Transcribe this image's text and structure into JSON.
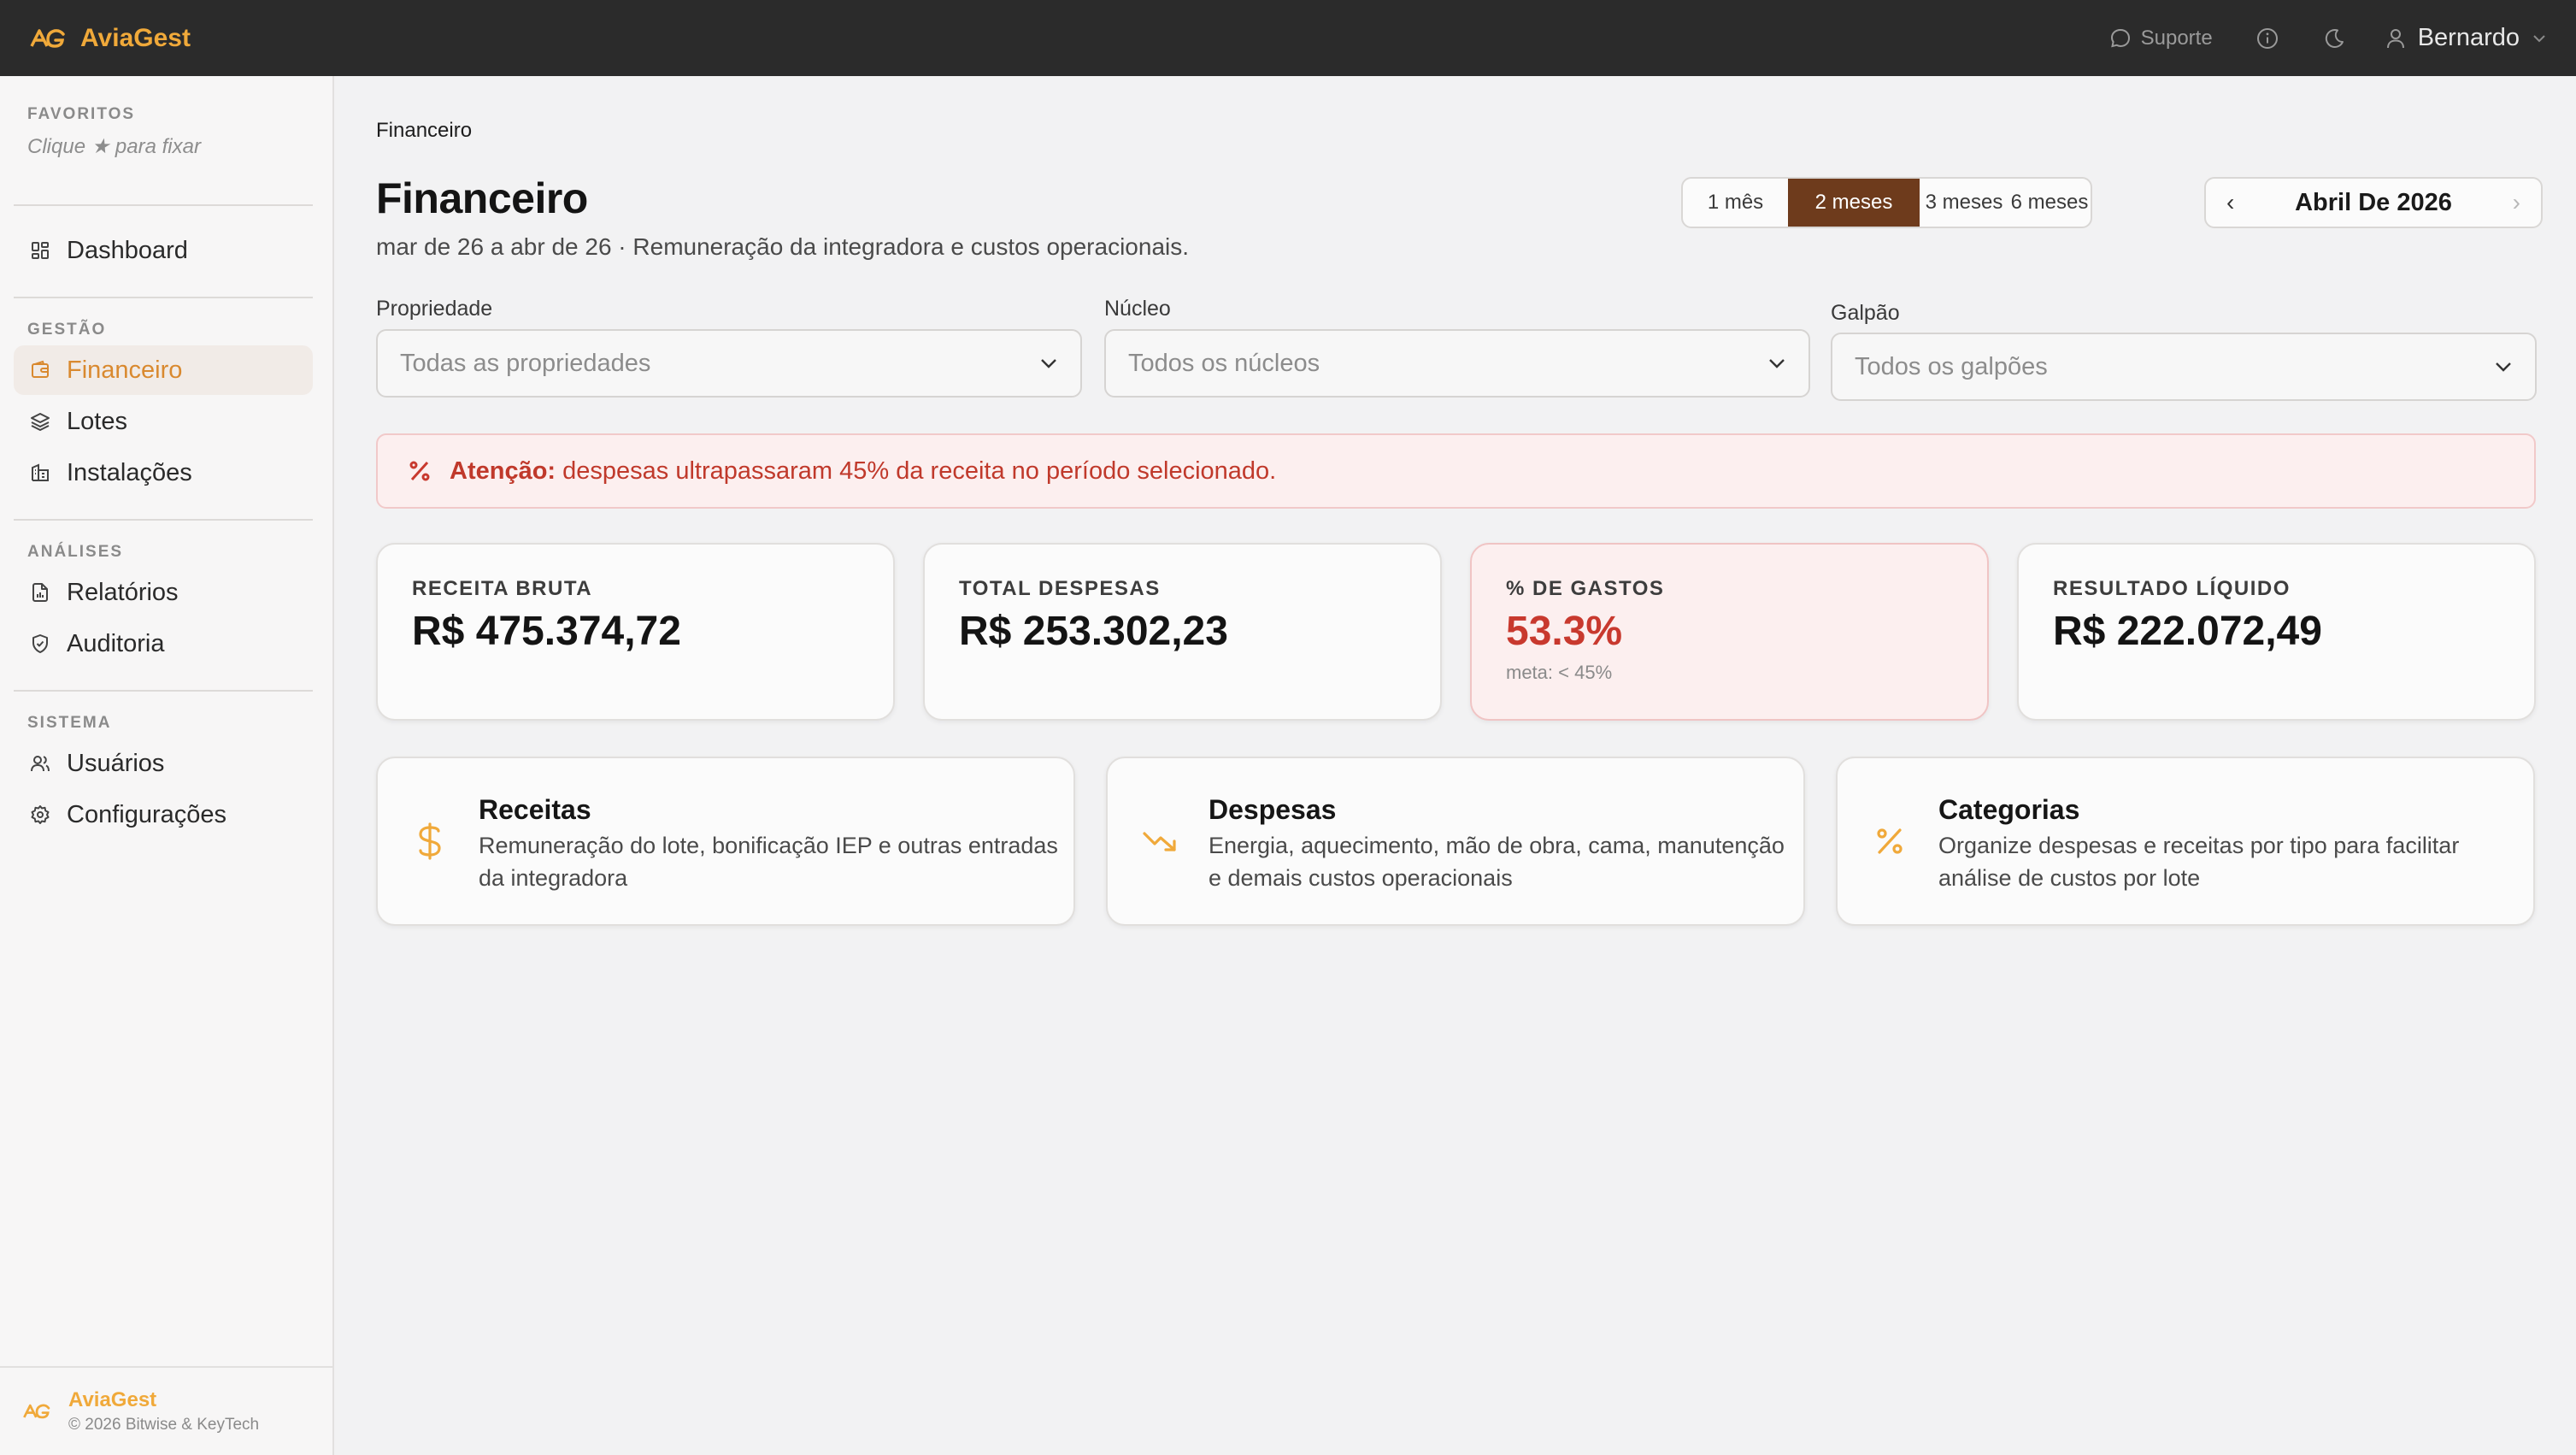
{
  "app": {
    "name": "AviaGest",
    "support_label": "Suporte",
    "user_name": "Bernardo"
  },
  "sidebar": {
    "favorites_title": "FAVORITOS",
    "favorites_hint": "Clique ★ para fixar",
    "dashboard_label": "Dashboard",
    "gestao_title": "GESTÃO",
    "gestao_items": [
      {
        "label": "Financeiro",
        "icon": "wallet-icon"
      },
      {
        "label": "Lotes",
        "icon": "layers-icon"
      },
      {
        "label": "Instalações",
        "icon": "building-icon"
      }
    ],
    "analises_title": "ANÁLISES",
    "analises_items": [
      {
        "label": "Relatórios",
        "icon": "report-icon"
      },
      {
        "label": "Auditoria",
        "icon": "shield-icon"
      }
    ],
    "sistema_title": "SISTEMA",
    "sistema_items": [
      {
        "label": "Usuários",
        "icon": "users-icon"
      },
      {
        "label": "Configurações",
        "icon": "gear-icon"
      }
    ],
    "footer_name": "AviaGest",
    "footer_copy": "© 2026 Bitwise & KeyTech"
  },
  "page": {
    "breadcrumb": "Financeiro",
    "title": "Financeiro",
    "subtitle": "mar de 26 a abr de 26 · Remuneração da integradora e custos operacionais."
  },
  "range": {
    "options": [
      "1 mês",
      "2 meses",
      "3 meses",
      "6 meses"
    ],
    "selected": "2 meses"
  },
  "month_nav": {
    "label": "Abril De 2026",
    "prev": "‹",
    "next": "›"
  },
  "filters": [
    {
      "label": "Propriedade",
      "placeholder": "Todas as propriedades"
    },
    {
      "label": "Núcleo",
      "placeholder": "Todos os núcleos"
    },
    {
      "label": "Galpão",
      "placeholder": "Todos os galpões"
    }
  ],
  "alert": {
    "strong": "Atenção:",
    "text": "despesas ultrapassaram 45% da receita no período selecionado."
  },
  "kpis": [
    {
      "label": "RECEITA BRUTA",
      "value": "R$ 475.374,72"
    },
    {
      "label": "TOTAL DESPESAS",
      "value": "R$ 253.302,23"
    },
    {
      "label": "% DE GASTOS",
      "value": "53.3%",
      "meta": "meta: < 45%"
    },
    {
      "label": "RESULTADO LÍQUIDO",
      "value": "R$ 222.072,49"
    }
  ],
  "cards": [
    {
      "title": "Receitas",
      "desc": "Remuneração do lote, bonificação IEP e outras entradas da integradora",
      "icon": "dollar-icon"
    },
    {
      "title": "Despesas",
      "desc": "Energia, aquecimento, mão de obra, cama, manutenção e demais custos operacionais",
      "icon": "trending-down-icon"
    },
    {
      "title": "Categorias",
      "desc": "Organize despesas e receitas por tipo para facilitar análise de custos por lote",
      "icon": "percent-icon"
    }
  ],
  "colors": {
    "accent": "#f0a93a",
    "active_range": "#6e3b1c",
    "danger": "#c8392e"
  }
}
